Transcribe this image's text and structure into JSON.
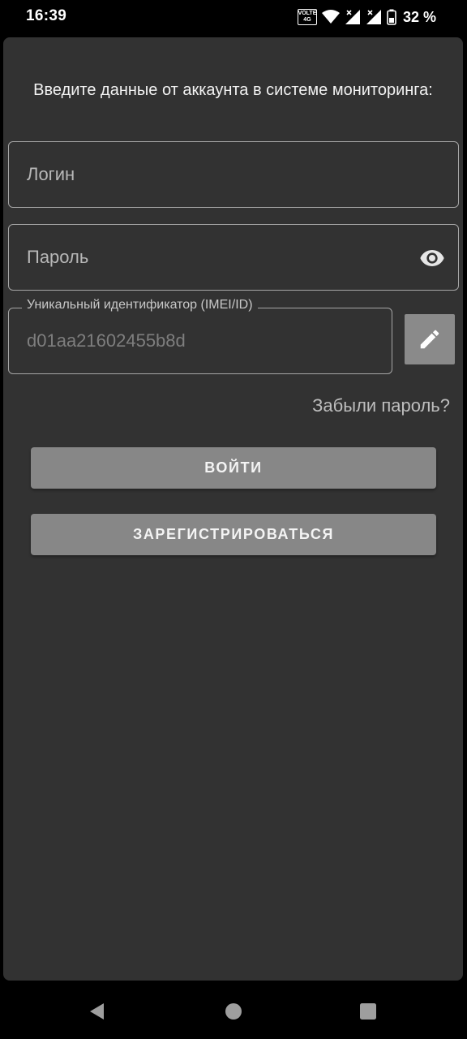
{
  "status_bar": {
    "time": "16:39",
    "volte_top": "VOLTE",
    "volte_bottom": "4G",
    "battery": "32 %"
  },
  "form": {
    "intro": "Введите данные от аккаунта в системе мониторинга:",
    "login_placeholder": "Логин",
    "password_placeholder": "Пароль",
    "imei_label": "Уникальный идентификатор (IMEI/ID)",
    "imei_value": "d01aa21602455b8d",
    "forgot_password": "Забыли пароль?",
    "login_button": "ВОЙТИ",
    "register_button": "ЗАРЕГИСТРИРОВАТЬСЯ"
  },
  "icons": {
    "password_toggle": "eye-icon",
    "edit_imei": "pencil-icon",
    "nav_back": "back-triangle-icon",
    "nav_home": "home-circle-icon",
    "nav_recents": "recents-square-icon"
  },
  "colors": {
    "background": "#000000",
    "card": "#323232",
    "button": "#878787",
    "field_border": "#a6a6a6"
  }
}
